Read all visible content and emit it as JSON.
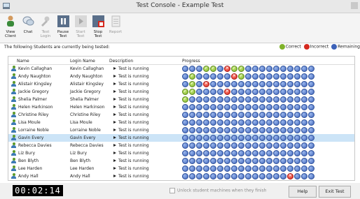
{
  "window": {
    "title": "Test Console - Example Test"
  },
  "toolbar": {
    "buttons": [
      {
        "line1": "View",
        "line2": "Client",
        "icon": "view-client-icon",
        "enabled": true
      },
      {
        "line1": "Chat",
        "line2": "",
        "icon": "chat-icon",
        "enabled": true
      },
      {
        "line1": "Test",
        "line2": "Login",
        "icon": "test-login-icon",
        "enabled": false
      },
      {
        "line1": "Pause",
        "line2": "Test",
        "icon": "pause-icon",
        "enabled": true
      },
      {
        "line1": "Start",
        "line2": "Test",
        "icon": "start-icon",
        "enabled": false
      },
      {
        "line1": "Stop",
        "line2": "Test",
        "icon": "stop-icon",
        "enabled": true
      },
      {
        "line1": "Report",
        "line2": "",
        "icon": "report-icon",
        "enabled": false
      }
    ]
  },
  "notice": "The following Students are currently being tested:",
  "legend": {
    "correct": "Correct",
    "incorrect": "Incorrect",
    "remaining": "Remaining"
  },
  "columns": {
    "name": "Name",
    "login": "Login Name",
    "description": "Description",
    "progress": "Progress"
  },
  "students": [
    {
      "name": "Kevin Callaghan",
      "login": "Kevin Callaghan",
      "description": "Test is running",
      "progress": "rrrccriccrrrrrrrrrr",
      "selected": false
    },
    {
      "name": "Andy Naughton",
      "login": "Andy Naughton",
      "description": "Test is running",
      "progress": "rcrrrrricrrrrrrrrrr",
      "selected": false
    },
    {
      "name": "Alistair Kingsley",
      "login": "Alistair Kingsley",
      "description": "Test is running",
      "progress": "rcrirrrrrrrrrrrrrrr",
      "selected": false
    },
    {
      "name": "Jackie Gregory",
      "login": "Jackie Gregory",
      "description": "Test is running",
      "progress": "ccrrrrirrrrrrrrrrrr",
      "selected": false
    },
    {
      "name": "Shelia Palmer",
      "login": "Shelia Palmer",
      "description": "Test is running",
      "progress": "crrrrrrrrrrrrrrrrrr",
      "selected": false
    },
    {
      "name": "Helen Harkinson",
      "login": "Helen Harkinson",
      "description": "Test is running",
      "progress": "rrrrrrrrrrrrrrrrrrr",
      "selected": false
    },
    {
      "name": "Christine Riley",
      "login": "Christine Riley",
      "description": "Test is running",
      "progress": "rrrrrrrrrrrrrrrrrrr",
      "selected": false
    },
    {
      "name": "Lisa Moule",
      "login": "Lisa Moule",
      "description": "Test is running",
      "progress": "rrrrrrrrrrrrrrrrrrr",
      "selected": false
    },
    {
      "name": "Lorraine Noble",
      "login": "Lorraine Noble",
      "description": "Test is running",
      "progress": "rrrrrrrrrrrrrrrrrrr",
      "selected": false
    },
    {
      "name": "Gavin Every",
      "login": "Gavin Every",
      "description": "Test is running",
      "progress": "rrrrrrrrrrrrrrrrrrr",
      "selected": true
    },
    {
      "name": "Rebecca Davies",
      "login": "Rebecca Davies",
      "description": "Test is running",
      "progress": "rrrrrrrrrrrrrrrrrrr",
      "selected": false
    },
    {
      "name": "Liz Bury",
      "login": "Liz Bury",
      "description": "Test is running",
      "progress": "rrrrrrrrrrrrrrrrrrr",
      "selected": false
    },
    {
      "name": "Ben Blyth",
      "login": "Ben Blyth",
      "description": "Test is running",
      "progress": "rrrrrrrrrrrrrrrrrrr",
      "selected": false
    },
    {
      "name": "Lee Harden",
      "login": "Lee Harden",
      "description": "Test is running",
      "progress": "rrrrrrrrrrrrrrrrrrr",
      "selected": false
    },
    {
      "name": "Andy Hall",
      "login": "Andy Hall",
      "description": "Test is running",
      "progress": "rrrrrrrrrrrrrrrirrr",
      "selected": false
    }
  ],
  "footer": {
    "timer": "00:02:14",
    "unlock_label": "Unlock student machines when they finish",
    "help_label": "Help",
    "exit_label": "Exit Test"
  },
  "colors": {
    "correct": "#7fb22a",
    "incorrect": "#d52a1f",
    "remaining": "#3d62b8",
    "selected_row": "#cce4f7"
  }
}
